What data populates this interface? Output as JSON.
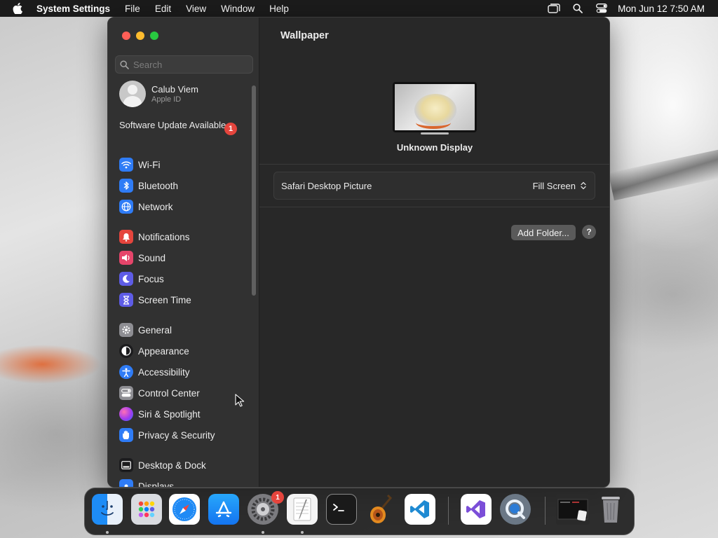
{
  "menubar": {
    "app_name": "System Settings",
    "menus": [
      "File",
      "Edit",
      "View",
      "Window",
      "Help"
    ],
    "clock": "Mon Jun 12  7:50 AM"
  },
  "sidebar": {
    "search_placeholder": "Search",
    "profile": {
      "name": "Calub Viem",
      "subtitle": "Apple ID"
    },
    "update": {
      "label": "Software Update Available",
      "badge": "1"
    },
    "items": [
      {
        "label": "Wi-Fi",
        "icon": "wifi-icon",
        "color": "#2f7cf6"
      },
      {
        "label": "Bluetooth",
        "icon": "bluetooth-icon",
        "color": "#2f7cf6"
      },
      {
        "label": "Network",
        "icon": "globe-icon",
        "color": "#2f7cf6"
      },
      {
        "label": "Notifications",
        "icon": "bell-icon",
        "color": "#e5453d"
      },
      {
        "label": "Sound",
        "icon": "speaker-icon",
        "color": "#e5456a"
      },
      {
        "label": "Focus",
        "icon": "moon-icon",
        "color": "#5e5ce6"
      },
      {
        "label": "Screen Time",
        "icon": "hourglass-icon",
        "color": "#5e5ce6"
      },
      {
        "label": "General",
        "icon": "gear-icon",
        "color": "#8e8e93"
      },
      {
        "label": "Appearance",
        "icon": "appearance-icon",
        "color": "#1c1c1e"
      },
      {
        "label": "Accessibility",
        "icon": "accessibility-icon",
        "color": "#2f7cf6"
      },
      {
        "label": "Control Center",
        "icon": "control-center-icon",
        "color": "#8e8e93"
      },
      {
        "label": "Siri & Spotlight",
        "icon": "siri-icon",
        "color": "#b04be0"
      },
      {
        "label": "Privacy & Security",
        "icon": "hand-icon",
        "color": "#2f7cf6"
      },
      {
        "label": "Desktop & Dock",
        "icon": "dock-icon",
        "color": "#1c1c1e"
      },
      {
        "label": "Displays",
        "icon": "sun-icon",
        "color": "#2f7cf6"
      }
    ]
  },
  "main": {
    "title": "Wallpaper",
    "display_name": "Unknown Display",
    "picture_name": "Safari Desktop Picture",
    "fill_mode": "Fill Screen",
    "add_folder_label": "Add Folder...",
    "help_label": "?"
  },
  "dock": {
    "settings_badge": "1",
    "apps": [
      "Finder",
      "Launchpad",
      "Safari",
      "App Store",
      "System Settings",
      "TextEdit",
      "Terminal",
      "GarageBand",
      "Visual Studio Code",
      "Visual Studio",
      "QuickTime Player",
      "Downloads",
      "Trash"
    ]
  }
}
